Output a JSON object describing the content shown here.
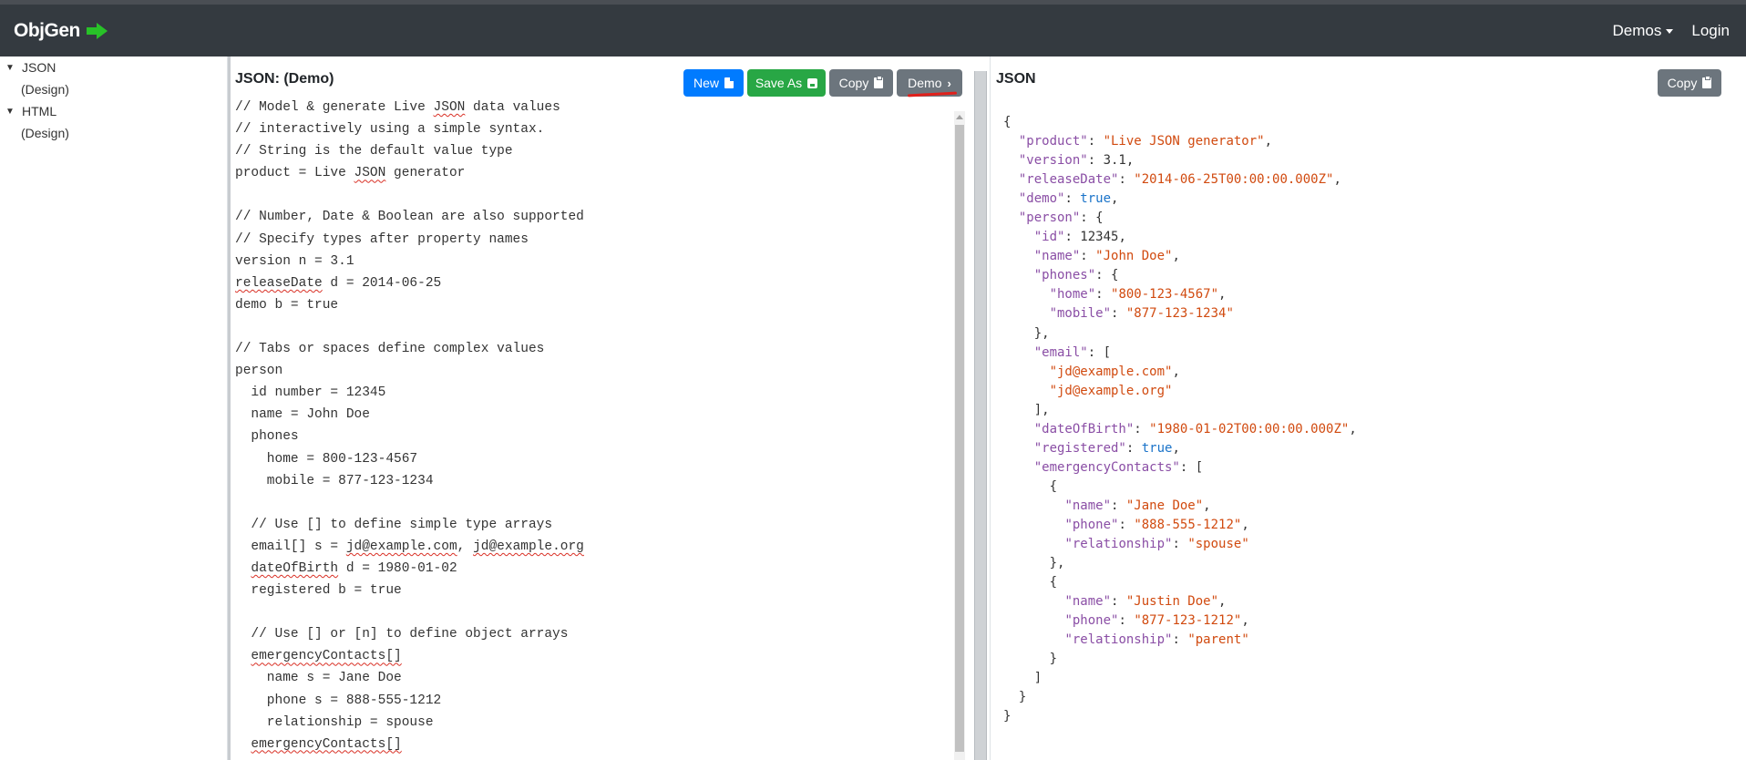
{
  "navbar": {
    "brand": "ObjGen",
    "demos_label": "Demos",
    "login_label": "Login",
    "bg_color": "#343a40",
    "brand_arrow_color": "#28c228"
  },
  "sidebar": {
    "items": [
      {
        "label": "JSON",
        "expanded": true
      },
      {
        "label": "(Design)"
      },
      {
        "label": "HTML",
        "expanded": true
      },
      {
        "label": "(Design)"
      }
    ]
  },
  "editor": {
    "title": "JSON: (Demo)",
    "buttons": {
      "new_label": "New",
      "saveas_label": "Save As",
      "copy_label": "Copy",
      "demo_label": "Demo"
    },
    "lines": [
      "// Model & generate Live JSON data values",
      "// interactively using a simple syntax.",
      "// String is the default value type",
      "product = Live JSON generator",
      "",
      "// Number, Date & Boolean are also supported",
      "// Specify types after property names",
      "version n = 3.1",
      "releaseDate d = 2014-06-25",
      "demo b = true",
      "",
      "// Tabs or spaces define complex values",
      "person",
      "  id number = 12345",
      "  name = John Doe",
      "  phones",
      "    home = 800-123-4567",
      "    mobile = 877-123-1234",
      "",
      "  // Use [] to define simple type arrays",
      "  email[] s = jd@example.com, jd@example.org",
      "  dateOfBirth d = 1980-01-02",
      "  registered b = true",
      "",
      "  // Use [] or [n] to define object arrays",
      "  emergencyContacts[]",
      "    name s = Jane Doe",
      "    phone s = 888-555-1212",
      "    relationship = spouse",
      "  emergencyContacts[]"
    ]
  },
  "output": {
    "title": "JSON",
    "copy_label": "Copy",
    "lines": [
      [
        {
          "t": "{"
        }
      ],
      [
        {
          "t": "  "
        },
        {
          "k": "\"product\""
        },
        {
          "t": ": "
        },
        {
          "s": "\"Live JSON generator\""
        },
        {
          "t": ","
        }
      ],
      [
        {
          "t": "  "
        },
        {
          "k": "\"version\""
        },
        {
          "t": ": "
        },
        {
          "n": "3.1"
        },
        {
          "t": ","
        }
      ],
      [
        {
          "t": "  "
        },
        {
          "k": "\"releaseDate\""
        },
        {
          "t": ": "
        },
        {
          "s": "\"2014-06-25T00:00:00.000Z\""
        },
        {
          "t": ","
        }
      ],
      [
        {
          "t": "  "
        },
        {
          "k": "\"demo\""
        },
        {
          "t": ": "
        },
        {
          "b": "true"
        },
        {
          "t": ","
        }
      ],
      [
        {
          "t": "  "
        },
        {
          "k": "\"person\""
        },
        {
          "t": ": {"
        }
      ],
      [
        {
          "t": "    "
        },
        {
          "k": "\"id\""
        },
        {
          "t": ": "
        },
        {
          "n": "12345"
        },
        {
          "t": ","
        }
      ],
      [
        {
          "t": "    "
        },
        {
          "k": "\"name\""
        },
        {
          "t": ": "
        },
        {
          "s": "\"John Doe\""
        },
        {
          "t": ","
        }
      ],
      [
        {
          "t": "    "
        },
        {
          "k": "\"phones\""
        },
        {
          "t": ": {"
        }
      ],
      [
        {
          "t": "      "
        },
        {
          "k": "\"home\""
        },
        {
          "t": ": "
        },
        {
          "s": "\"800-123-4567\""
        },
        {
          "t": ","
        }
      ],
      [
        {
          "t": "      "
        },
        {
          "k": "\"mobile\""
        },
        {
          "t": ": "
        },
        {
          "s": "\"877-123-1234\""
        }
      ],
      [
        {
          "t": "    },"
        }
      ],
      [
        {
          "t": "    "
        },
        {
          "k": "\"email\""
        },
        {
          "t": ": ["
        }
      ],
      [
        {
          "t": "      "
        },
        {
          "s": "\"jd@example.com\""
        },
        {
          "t": ","
        }
      ],
      [
        {
          "t": "      "
        },
        {
          "s": "\"jd@example.org\""
        }
      ],
      [
        {
          "t": "    ],"
        }
      ],
      [
        {
          "t": "    "
        },
        {
          "k": "\"dateOfBirth\""
        },
        {
          "t": ": "
        },
        {
          "s": "\"1980-01-02T00:00:00.000Z\""
        },
        {
          "t": ","
        }
      ],
      [
        {
          "t": "    "
        },
        {
          "k": "\"registered\""
        },
        {
          "t": ": "
        },
        {
          "b": "true"
        },
        {
          "t": ","
        }
      ],
      [
        {
          "t": "    "
        },
        {
          "k": "\"emergencyContacts\""
        },
        {
          "t": ": ["
        }
      ],
      [
        {
          "t": "      {"
        }
      ],
      [
        {
          "t": "        "
        },
        {
          "k": "\"name\""
        },
        {
          "t": ": "
        },
        {
          "s": "\"Jane Doe\""
        },
        {
          "t": ","
        }
      ],
      [
        {
          "t": "        "
        },
        {
          "k": "\"phone\""
        },
        {
          "t": ": "
        },
        {
          "s": "\"888-555-1212\""
        },
        {
          "t": ","
        }
      ],
      [
        {
          "t": "        "
        },
        {
          "k": "\"relationship\""
        },
        {
          "t": ": "
        },
        {
          "s": "\"spouse\""
        }
      ],
      [
        {
          "t": "      },"
        }
      ],
      [
        {
          "t": "      {"
        }
      ],
      [
        {
          "t": "        "
        },
        {
          "k": "\"name\""
        },
        {
          "t": ": "
        },
        {
          "s": "\"Justin Doe\""
        },
        {
          "t": ","
        }
      ],
      [
        {
          "t": "        "
        },
        {
          "k": "\"phone\""
        },
        {
          "t": ": "
        },
        {
          "s": "\"877-123-1212\""
        },
        {
          "t": ","
        }
      ],
      [
        {
          "t": "        "
        },
        {
          "k": "\"relationship\""
        },
        {
          "t": ": "
        },
        {
          "s": "\"parent\""
        }
      ],
      [
        {
          "t": "      }"
        }
      ],
      [
        {
          "t": "    ]"
        }
      ],
      [
        {
          "t": "  }"
        }
      ],
      [
        {
          "t": "}"
        }
      ]
    ]
  },
  "colors": {
    "key": "#8a4ea5",
    "string": "#d14a0f",
    "boolean": "#1a73c9",
    "btn_primary": "#007bff",
    "btn_success": "#28a745",
    "btn_secondary": "#6c757d"
  }
}
